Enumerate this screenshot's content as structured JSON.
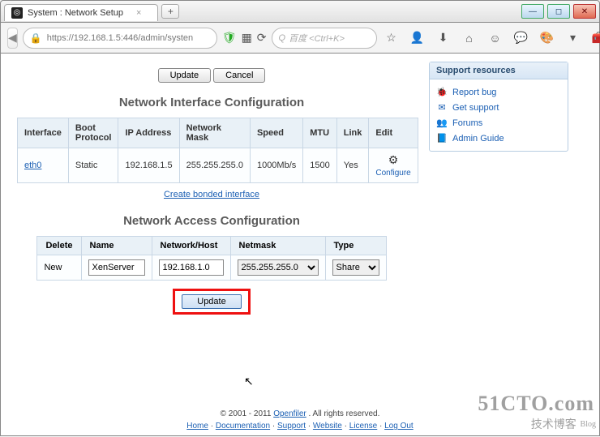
{
  "window": {
    "tab_title": "System : Network Setup",
    "url": "https://192.168.1.5:446/admin/systen",
    "search_placeholder": "百度 <Ctrl+K>"
  },
  "top_buttons": {
    "update": "Update",
    "cancel": "Cancel"
  },
  "sidebar": {
    "title": "Support resources",
    "items": [
      {
        "icon": "🐞",
        "label": "Report bug"
      },
      {
        "icon": "✉",
        "label": "Get support"
      },
      {
        "icon": "👥",
        "label": "Forums"
      },
      {
        "icon": "📘",
        "label": "Admin Guide"
      }
    ]
  },
  "nic_section": {
    "title": "Network Interface Configuration",
    "headers": [
      "Interface",
      "Boot Protocol",
      "IP Address",
      "Network Mask",
      "Speed",
      "MTU",
      "Link",
      "Edit"
    ],
    "row": {
      "interface": "eth0",
      "boot_protocol": "Static",
      "ip": "192.168.1.5",
      "mask": "255.255.255.0",
      "speed": "1000Mb/s",
      "mtu": "1500",
      "link": "Yes",
      "edit_label": "Configure"
    },
    "bonded_link": "Create bonded interface"
  },
  "nac_section": {
    "title": "Network Access Configuration",
    "headers": [
      "Delete",
      "Name",
      "Network/Host",
      "Netmask",
      "Type"
    ],
    "row": {
      "delete_label": "New",
      "name_value": "XenServer",
      "network_value": "192.168.1.0",
      "netmask_value": "255.255.255.0",
      "type_value": "Share"
    },
    "update_btn": "Update"
  },
  "footer": {
    "copyright": "© 2001 - 2011 ",
    "brand": "Openfiler",
    "rights": ". All rights reserved.",
    "links": [
      "Home",
      "Documentation",
      "Support",
      "Website",
      "License",
      "Log Out"
    ]
  },
  "watermark": {
    "line1": "51CTO.com",
    "line2": "技术博客",
    "blog": "Blog"
  }
}
